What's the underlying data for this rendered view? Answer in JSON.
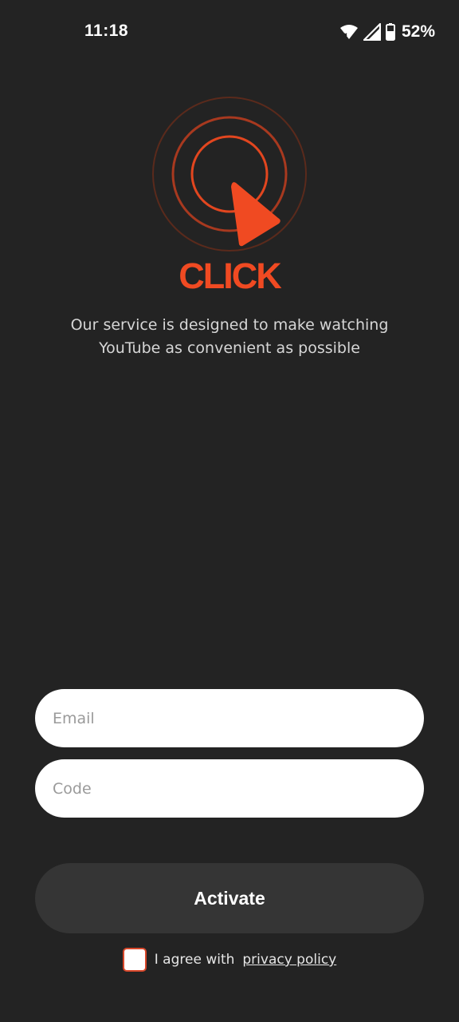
{
  "status_bar": {
    "time": "11:18",
    "battery_percent": "52%",
    "icons": [
      "wifi-icon",
      "signal-icon",
      "battery-icon"
    ]
  },
  "brand": {
    "name": "CLICK",
    "logo_icon": "click-logo-icon",
    "accent_color": "#f04a22"
  },
  "tagline": {
    "line1": "Our service is designed to make watching",
    "line2": "YouTube as convenient as possible"
  },
  "form": {
    "email_placeholder": "Email",
    "email_value": "",
    "code_placeholder": "Code",
    "code_value": "",
    "activate_label": "Activate"
  },
  "agreement": {
    "checked": false,
    "text": "I agree with",
    "link_label": "privacy policy"
  }
}
